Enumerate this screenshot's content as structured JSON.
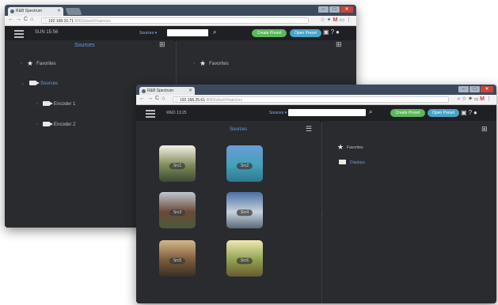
{
  "back_window": {
    "tab_title": "R&B Spectrum",
    "url_host": "192.168.10.71",
    "url_path": ":8083/zbw/#/main/src",
    "clock": "SUN 15:56",
    "sources_selector": "Sources ▾",
    "left_pane_title": "Sources",
    "tree": [
      {
        "label": "Favorites",
        "icon": "star-icon"
      },
      {
        "label": "Sources",
        "icon": "camera-icon"
      },
      {
        "label": "Encoder 1",
        "icon": "camera-icon"
      },
      {
        "label": "Encoder 2",
        "icon": "camera-icon"
      }
    ],
    "right_tree": [
      {
        "label": "Favorites",
        "icon": "star-icon"
      }
    ],
    "create_preset_label": "Create Preset",
    "open_preset_label": "Open Preset"
  },
  "front_window": {
    "tab_title": "R&B Spectrum",
    "url_host": "192.168.25.61",
    "url_path": ":8083/zbw/#/main/src",
    "clock": "WED 13:25",
    "sources_selector": "Sources ▾",
    "left_pane_title": "Sources",
    "thumbnails": [
      {
        "label": "Src1",
        "colors": [
          "#f4f0e4",
          "#7f8a5a",
          "#3d4a34"
        ]
      },
      {
        "label": "Src2",
        "colors": [
          "#6a9dd8",
          "#44a0b8",
          "#2e7890"
        ]
      },
      {
        "label": "Src3",
        "colors": [
          "#bfc9cf",
          "#6a4a38",
          "#4b5a3a"
        ]
      },
      {
        "label": "Src4",
        "colors": [
          "#4a6fa4",
          "#c8d2dd",
          "#5a6a7a"
        ]
      },
      {
        "label": "Src5",
        "colors": [
          "#d4b888",
          "#7a5a3a",
          "#3a3026"
        ]
      },
      {
        "label": "Src6",
        "colors": [
          "#f0e8b0",
          "#8fa050",
          "#6a5a30"
        ]
      }
    ],
    "right_tree": [
      {
        "label": "Favorites",
        "icon": "star-icon"
      },
      {
        "label": "Displays",
        "icon": "display-icon"
      }
    ],
    "create_preset_label": "Create Preset",
    "open_preset_label": "Open Preset"
  },
  "colors": {
    "accent_blue": "#6c9be8",
    "create_green": "#5cb85c",
    "open_teal": "#4aa3c9",
    "app_bg": "#2a2b2e"
  }
}
